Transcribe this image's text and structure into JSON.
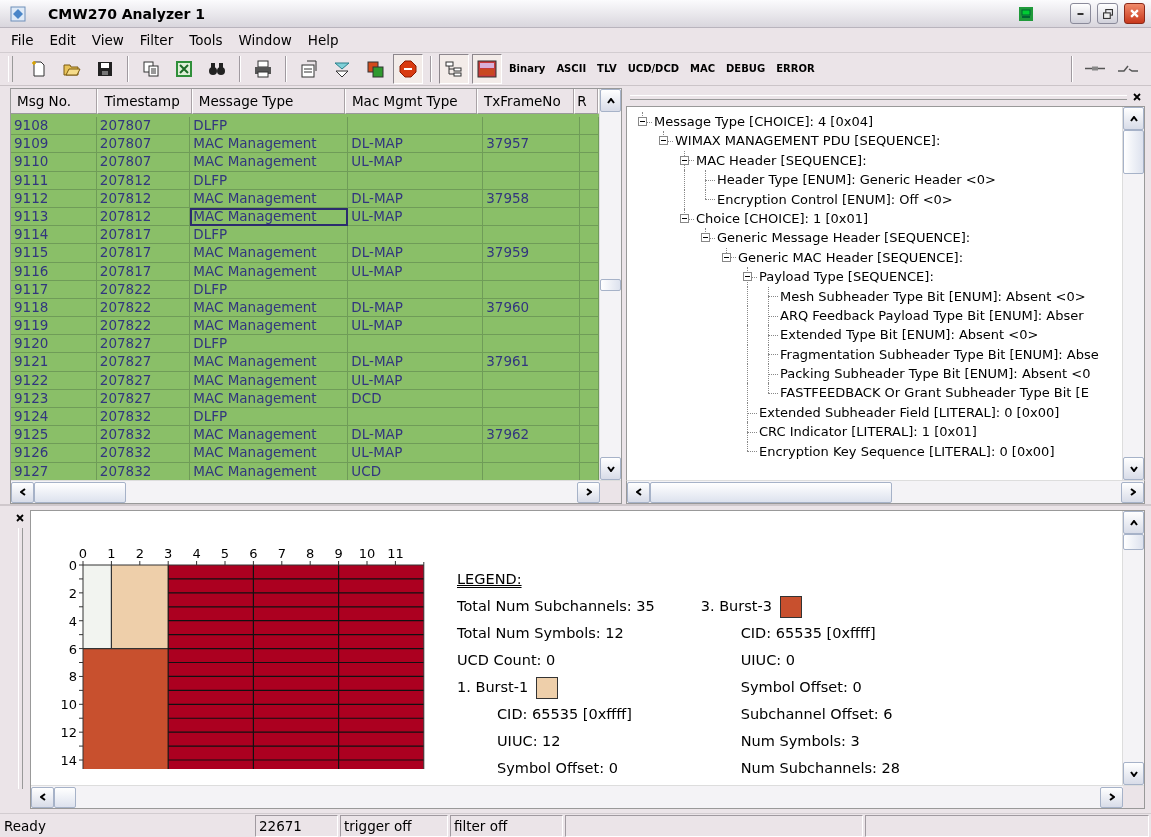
{
  "window": {
    "title": "CMW270 Analyzer 1"
  },
  "menu": [
    "File",
    "Edit",
    "View",
    "Filter",
    "Tools",
    "Window",
    "Help"
  ],
  "toolbar": [
    {
      "kind": "new",
      "pressed": false
    },
    {
      "kind": "open",
      "pressed": false
    },
    {
      "kind": "save",
      "pressed": false
    },
    {
      "kind": "separator"
    },
    {
      "kind": "copy",
      "pressed": false
    },
    {
      "kind": "spreadsheet",
      "pressed": false
    },
    {
      "kind": "find",
      "pressed": false
    },
    {
      "kind": "separator"
    },
    {
      "kind": "print",
      "pressed": false
    },
    {
      "kind": "separator"
    },
    {
      "kind": "properties",
      "pressed": false
    },
    {
      "kind": "filter",
      "pressed": false
    },
    {
      "kind": "windows",
      "pressed": false
    },
    {
      "kind": "stop",
      "pressed": true
    },
    {
      "kind": "separator"
    },
    {
      "kind": "tree",
      "pressed": true
    },
    {
      "kind": "colorpanel",
      "pressed": true
    },
    {
      "kind": "text",
      "label": "Binary",
      "pressed": false
    },
    {
      "kind": "text",
      "label": "ASCII",
      "pressed": false
    },
    {
      "kind": "text",
      "label": "TLV",
      "pressed": false
    },
    {
      "kind": "text",
      "label": "UCD/DCD",
      "pressed": false
    },
    {
      "kind": "text",
      "label": "MAC",
      "pressed": false
    },
    {
      "kind": "text",
      "label": "DEBUG",
      "pressed": false
    },
    {
      "kind": "text",
      "label": "ERROR",
      "pressed": false
    },
    {
      "kind": "spacer"
    },
    {
      "kind": "separator"
    },
    {
      "kind": "connect",
      "pressed": false
    },
    {
      "kind": "disconnect",
      "pressed": false
    }
  ],
  "table": {
    "columns": [
      "Msg No.",
      "Timestamp",
      "Message Type",
      "Mac Mgmt Type",
      "TxFrameNo",
      "R"
    ],
    "rows": [
      {
        "cells": [
          "9108",
          "207807",
          "DLFP",
          "",
          "",
          ""
        ],
        "focused": false
      },
      {
        "cells": [
          "9109",
          "207807",
          "MAC Management",
          "DL-MAP",
          "37957",
          ""
        ],
        "focused": false
      },
      {
        "cells": [
          "9110",
          "207807",
          "MAC Management",
          "UL-MAP",
          "",
          ""
        ],
        "focused": false
      },
      {
        "cells": [
          "9111",
          "207812",
          "DLFP",
          "",
          "",
          ""
        ],
        "focused": false
      },
      {
        "cells": [
          "9112",
          "207812",
          "MAC Management",
          "DL-MAP",
          "37958",
          ""
        ],
        "focused": false
      },
      {
        "cells": [
          "9113",
          "207812",
          "MAC Management",
          "UL-MAP",
          "",
          ""
        ],
        "focused": true
      },
      {
        "cells": [
          "9114",
          "207817",
          "DLFP",
          "",
          "",
          ""
        ],
        "focused": false
      },
      {
        "cells": [
          "9115",
          "207817",
          "MAC Management",
          "DL-MAP",
          "37959",
          ""
        ],
        "focused": false
      },
      {
        "cells": [
          "9116",
          "207817",
          "MAC Management",
          "UL-MAP",
          "",
          ""
        ],
        "focused": false
      },
      {
        "cells": [
          "9117",
          "207822",
          "DLFP",
          "",
          "",
          ""
        ],
        "focused": false
      },
      {
        "cells": [
          "9118",
          "207822",
          "MAC Management",
          "DL-MAP",
          "37960",
          ""
        ],
        "focused": false
      },
      {
        "cells": [
          "9119",
          "207822",
          "MAC Management",
          "UL-MAP",
          "",
          ""
        ],
        "focused": false
      },
      {
        "cells": [
          "9120",
          "207827",
          "DLFP",
          "",
          "",
          ""
        ],
        "focused": false
      },
      {
        "cells": [
          "9121",
          "207827",
          "MAC Management",
          "DL-MAP",
          "37961",
          ""
        ],
        "focused": false
      },
      {
        "cells": [
          "9122",
          "207827",
          "MAC Management",
          "UL-MAP",
          "",
          ""
        ],
        "focused": false
      },
      {
        "cells": [
          "9123",
          "207827",
          "MAC Management",
          "DCD",
          "",
          ""
        ],
        "focused": false
      },
      {
        "cells": [
          "9124",
          "207832",
          "DLFP",
          "",
          "",
          ""
        ],
        "focused": false
      },
      {
        "cells": [
          "9125",
          "207832",
          "MAC Management",
          "DL-MAP",
          "37962",
          ""
        ],
        "focused": false
      },
      {
        "cells": [
          "9126",
          "207832",
          "MAC Management",
          "UL-MAP",
          "",
          ""
        ],
        "focused": false
      },
      {
        "cells": [
          "9127",
          "207832",
          "MAC Management",
          "UCD",
          "",
          ""
        ],
        "focused": false
      }
    ]
  },
  "tree": [
    {
      "label": "Message Type [CHOICE]: 4 [0x04]",
      "expanded": true,
      "children": [
        {
          "label": "WIMAX MANAGEMENT PDU [SEQUENCE]:",
          "expanded": true,
          "children": [
            {
              "label": "MAC Header [SEQUENCE]:",
              "expanded": true,
              "children": [
                {
                  "label": "Header Type [ENUM]: Generic Header <0>"
                },
                {
                  "label": "Encryption Control [ENUM]: Off <0>"
                }
              ]
            },
            {
              "label": "Choice [CHOICE]: 1 [0x01]",
              "expanded": true,
              "children": [
                {
                  "label": "Generic Message Header [SEQUENCE]:",
                  "expanded": true,
                  "children": [
                    {
                      "label": "Generic MAC Header [SEQUENCE]:",
                      "expanded": true,
                      "children": [
                        {
                          "label": "Payload Type [SEQUENCE]:",
                          "expanded": true,
                          "children": [
                            {
                              "label": "Mesh Subheader Type Bit [ENUM]: Absent <0>"
                            },
                            {
                              "label": "ARQ Feedback Payload Type Bit [ENUM]: Abser"
                            },
                            {
                              "label": "Extended Type Bit [ENUM]: Absent <0>"
                            },
                            {
                              "label": "Fragmentation Subheader Type Bit [ENUM]: Abse"
                            },
                            {
                              "label": "Packing Subheader Type Bit [ENUM]: Absent <0"
                            },
                            {
                              "label": "FASTFEEDBACK Or Grant Subheader Type Bit [E"
                            }
                          ]
                        },
                        {
                          "label": "Extended Subheader Field [LITERAL]: 0 [0x00]"
                        },
                        {
                          "label": "CRC Indicator [LITERAL]: 1 [0x01]"
                        },
                        {
                          "label": "Encryption Key Sequence [LITERAL]: 0 [0x00]"
                        }
                      ]
                    }
                  ]
                }
              ]
            }
          ]
        }
      ]
    }
  ],
  "burst_map": {
    "x_ticks": [
      "0",
      "1",
      "2",
      "3",
      "4",
      "5",
      "6",
      "7",
      "8",
      "9",
      "10",
      "11"
    ],
    "y_ticks": [
      "0",
      "2",
      "4",
      "6",
      "8",
      "10",
      "12",
      "14"
    ]
  },
  "legend": {
    "title": "LEGEND:",
    "summary": [
      "Total Num Subchannels: 35",
      "Total Num Symbols: 12",
      "UCD Count: 0"
    ],
    "bursts": [
      {
        "label": "1. Burst-1",
        "color": "#eecfaa",
        "fields": [
          "CID: 65535 [0xffff]",
          "UIUC: 12",
          "Symbol Offset: 0"
        ]
      },
      {
        "label": "3. Burst-3",
        "color": "#c8502e",
        "fields": [
          "CID: 65535 [0xffff]",
          "UIUC: 0",
          "Symbol Offset: 0",
          "Subchannel Offset: 6",
          "Num Symbols: 3",
          "Num Subchannels: 28"
        ]
      }
    ]
  },
  "status_bar": [
    "Ready",
    "22671",
    "trigger off",
    "filter off"
  ]
}
